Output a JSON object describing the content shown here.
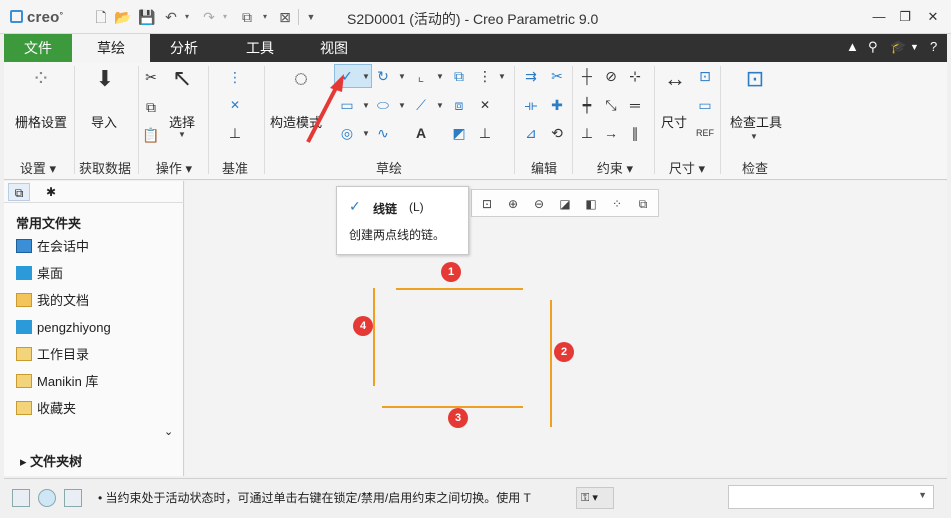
{
  "app": {
    "brand": "creo",
    "window_title": "S2D0001 (活动的) - Creo Parametric 9.0"
  },
  "tabs": [
    "文件",
    "草绘",
    "分析",
    "工具",
    "视图"
  ],
  "ribbon": {
    "groups": {
      "setup": "设置",
      "get_data": "获取数据",
      "operations": "操作",
      "datum": "基准",
      "sketch": "草绘",
      "edit": "编辑",
      "constrain": "约束",
      "dimension": "尺寸",
      "inspect": "检查"
    },
    "buttons": {
      "grid_settings": "栅格设置",
      "import": "导入",
      "select": "选择",
      "construction_mode": "构造模式",
      "dimension": "尺寸",
      "inspect_tools": "检查工具"
    }
  },
  "tooltip": {
    "title": "线链",
    "shortcut": "(L)",
    "description": "创建两点线的链。"
  },
  "left_panel": {
    "heading": "常用文件夹",
    "items": [
      "在会话中",
      "桌面",
      "我的文档",
      "pengzhiyong",
      "工作目录",
      "Manikin 库",
      "收藏夹"
    ],
    "folder_tree": "文件夹树"
  },
  "sketch": {
    "markers": [
      "1",
      "2",
      "3",
      "4"
    ],
    "line_color": "#f0a020",
    "marker_color": "#e53935"
  },
  "status": {
    "message": "当约束处于活动状态时，可通过单击右键在锁定/禁用/启用约束之间切换。使用 T"
  },
  "colors": {
    "file_tab": "#3c9a3c",
    "tabbar": "#313131",
    "accent": "#2c7cc6"
  }
}
